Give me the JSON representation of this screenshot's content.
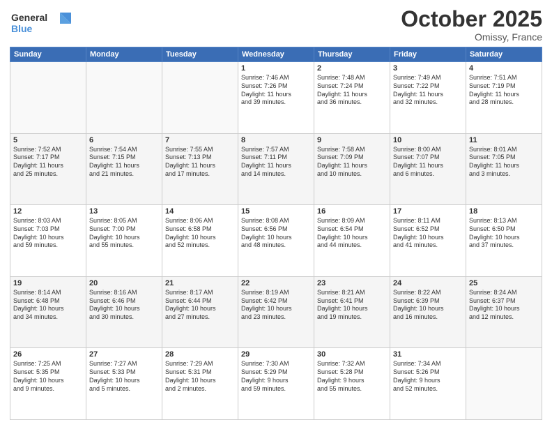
{
  "header": {
    "logo_line1": "General",
    "logo_line2": "Blue",
    "title": "October 2025",
    "subtitle": "Omissy, France"
  },
  "weekdays": [
    "Sunday",
    "Monday",
    "Tuesday",
    "Wednesday",
    "Thursday",
    "Friday",
    "Saturday"
  ],
  "weeks": [
    [
      {
        "day": "",
        "info": ""
      },
      {
        "day": "",
        "info": ""
      },
      {
        "day": "",
        "info": ""
      },
      {
        "day": "1",
        "info": "Sunrise: 7:46 AM\nSunset: 7:26 PM\nDaylight: 11 hours\nand 39 minutes."
      },
      {
        "day": "2",
        "info": "Sunrise: 7:48 AM\nSunset: 7:24 PM\nDaylight: 11 hours\nand 36 minutes."
      },
      {
        "day": "3",
        "info": "Sunrise: 7:49 AM\nSunset: 7:22 PM\nDaylight: 11 hours\nand 32 minutes."
      },
      {
        "day": "4",
        "info": "Sunrise: 7:51 AM\nSunset: 7:19 PM\nDaylight: 11 hours\nand 28 minutes."
      }
    ],
    [
      {
        "day": "5",
        "info": "Sunrise: 7:52 AM\nSunset: 7:17 PM\nDaylight: 11 hours\nand 25 minutes."
      },
      {
        "day": "6",
        "info": "Sunrise: 7:54 AM\nSunset: 7:15 PM\nDaylight: 11 hours\nand 21 minutes."
      },
      {
        "day": "7",
        "info": "Sunrise: 7:55 AM\nSunset: 7:13 PM\nDaylight: 11 hours\nand 17 minutes."
      },
      {
        "day": "8",
        "info": "Sunrise: 7:57 AM\nSunset: 7:11 PM\nDaylight: 11 hours\nand 14 minutes."
      },
      {
        "day": "9",
        "info": "Sunrise: 7:58 AM\nSunset: 7:09 PM\nDaylight: 11 hours\nand 10 minutes."
      },
      {
        "day": "10",
        "info": "Sunrise: 8:00 AM\nSunset: 7:07 PM\nDaylight: 11 hours\nand 6 minutes."
      },
      {
        "day": "11",
        "info": "Sunrise: 8:01 AM\nSunset: 7:05 PM\nDaylight: 11 hours\nand 3 minutes."
      }
    ],
    [
      {
        "day": "12",
        "info": "Sunrise: 8:03 AM\nSunset: 7:03 PM\nDaylight: 10 hours\nand 59 minutes."
      },
      {
        "day": "13",
        "info": "Sunrise: 8:05 AM\nSunset: 7:00 PM\nDaylight: 10 hours\nand 55 minutes."
      },
      {
        "day": "14",
        "info": "Sunrise: 8:06 AM\nSunset: 6:58 PM\nDaylight: 10 hours\nand 52 minutes."
      },
      {
        "day": "15",
        "info": "Sunrise: 8:08 AM\nSunset: 6:56 PM\nDaylight: 10 hours\nand 48 minutes."
      },
      {
        "day": "16",
        "info": "Sunrise: 8:09 AM\nSunset: 6:54 PM\nDaylight: 10 hours\nand 44 minutes."
      },
      {
        "day": "17",
        "info": "Sunrise: 8:11 AM\nSunset: 6:52 PM\nDaylight: 10 hours\nand 41 minutes."
      },
      {
        "day": "18",
        "info": "Sunrise: 8:13 AM\nSunset: 6:50 PM\nDaylight: 10 hours\nand 37 minutes."
      }
    ],
    [
      {
        "day": "19",
        "info": "Sunrise: 8:14 AM\nSunset: 6:48 PM\nDaylight: 10 hours\nand 34 minutes."
      },
      {
        "day": "20",
        "info": "Sunrise: 8:16 AM\nSunset: 6:46 PM\nDaylight: 10 hours\nand 30 minutes."
      },
      {
        "day": "21",
        "info": "Sunrise: 8:17 AM\nSunset: 6:44 PM\nDaylight: 10 hours\nand 27 minutes."
      },
      {
        "day": "22",
        "info": "Sunrise: 8:19 AM\nSunset: 6:42 PM\nDaylight: 10 hours\nand 23 minutes."
      },
      {
        "day": "23",
        "info": "Sunrise: 8:21 AM\nSunset: 6:41 PM\nDaylight: 10 hours\nand 19 minutes."
      },
      {
        "day": "24",
        "info": "Sunrise: 8:22 AM\nSunset: 6:39 PM\nDaylight: 10 hours\nand 16 minutes."
      },
      {
        "day": "25",
        "info": "Sunrise: 8:24 AM\nSunset: 6:37 PM\nDaylight: 10 hours\nand 12 minutes."
      }
    ],
    [
      {
        "day": "26",
        "info": "Sunrise: 7:25 AM\nSunset: 5:35 PM\nDaylight: 10 hours\nand 9 minutes."
      },
      {
        "day": "27",
        "info": "Sunrise: 7:27 AM\nSunset: 5:33 PM\nDaylight: 10 hours\nand 5 minutes."
      },
      {
        "day": "28",
        "info": "Sunrise: 7:29 AM\nSunset: 5:31 PM\nDaylight: 10 hours\nand 2 minutes."
      },
      {
        "day": "29",
        "info": "Sunrise: 7:30 AM\nSunset: 5:29 PM\nDaylight: 9 hours\nand 59 minutes."
      },
      {
        "day": "30",
        "info": "Sunrise: 7:32 AM\nSunset: 5:28 PM\nDaylight: 9 hours\nand 55 minutes."
      },
      {
        "day": "31",
        "info": "Sunrise: 7:34 AM\nSunset: 5:26 PM\nDaylight: 9 hours\nand 52 minutes."
      },
      {
        "day": "",
        "info": ""
      }
    ]
  ]
}
